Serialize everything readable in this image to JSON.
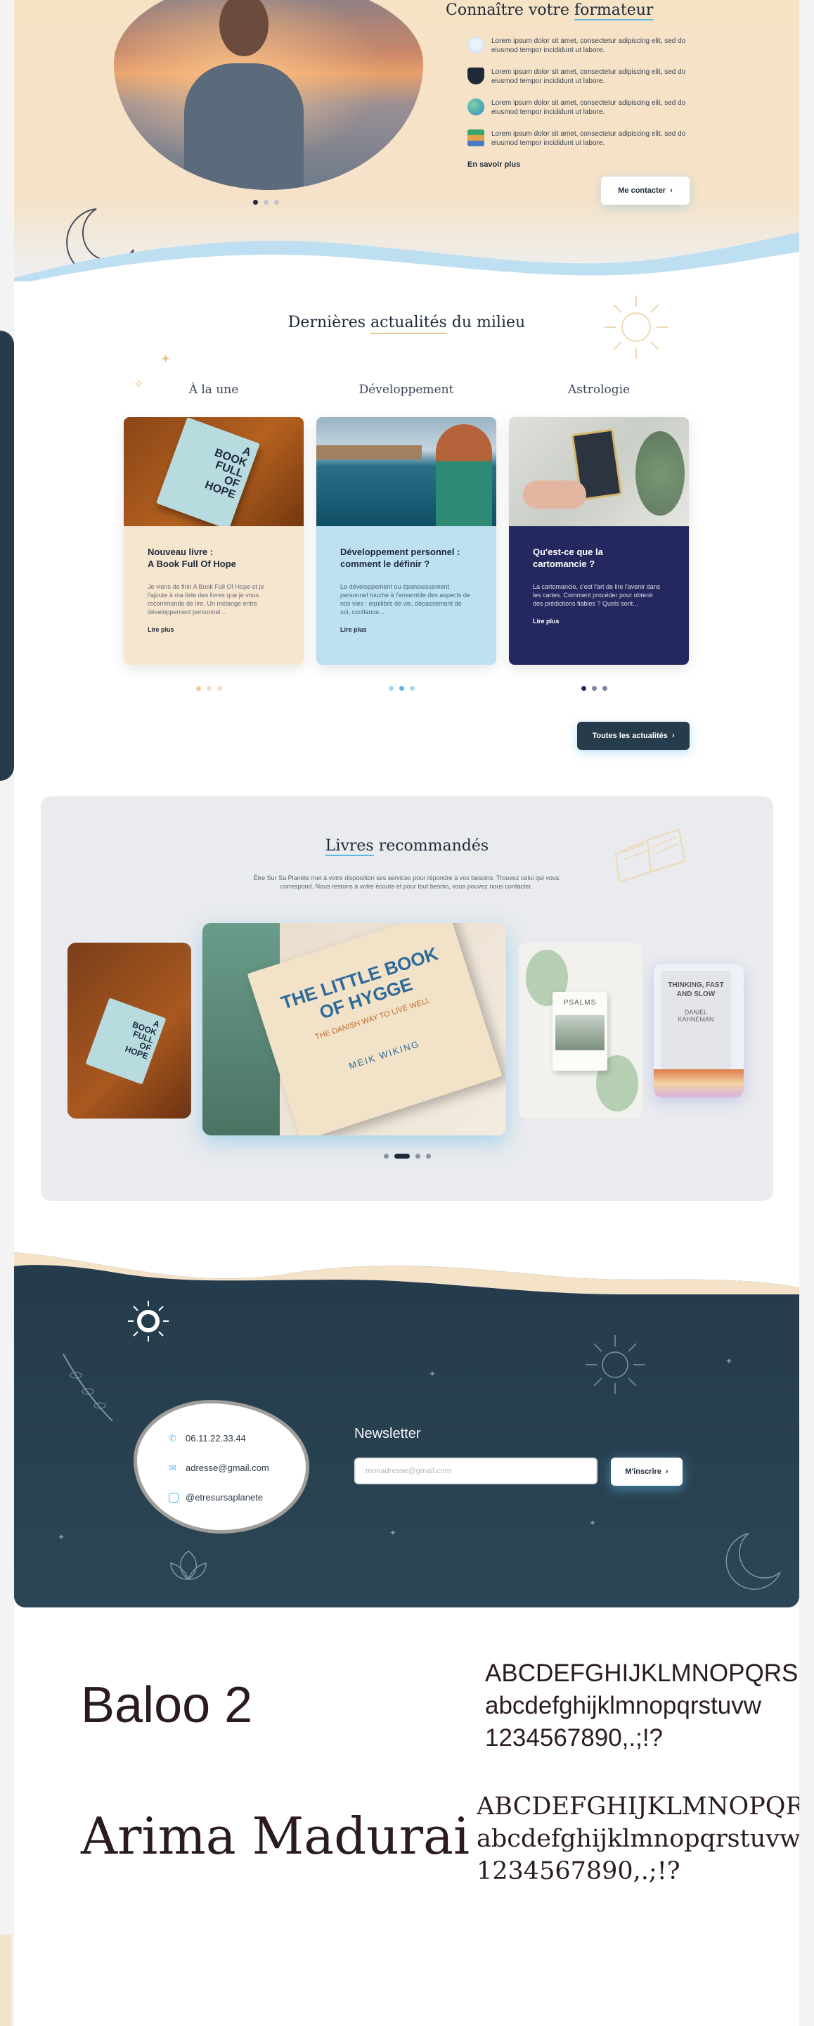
{
  "trainer": {
    "title_pre": "Connaître votre ",
    "title_hl": "formateur",
    "features": [
      "Lorem ipsum dolor sit amet, consectetur adipiscing elit, sed do eiusmod tempor incididunt ut labore.",
      "Lorem ipsum dolor sit amet, consectetur adipiscing elit, sed do eiusmod tempor incididunt ut labore.",
      "Lorem ipsum dolor sit amet, consectetur adipiscing elit, sed do eiusmod tempor incididunt ut labore.",
      "Lorem ipsum dolor sit amet, consectetur adipiscing elit, sed do eiusmod tempor incididunt ut labore."
    ],
    "learn_more": "En savoir plus",
    "contact_button": "Me contacter"
  },
  "news": {
    "title_pre": "Dernières ",
    "title_hl": "actualités",
    "title_post": " du milieu",
    "columns": [
      {
        "heading": "À la une",
        "title": "Nouveau livre :\nA Book Full Of Hope",
        "excerpt": "Je viens de finir A Book Full Of Hope et je l'ajoute à ma liste des livres que je vous recommande de lire. Un mélange entre développement personnel...",
        "more": "Lire plus",
        "book_text": "A\nBOOK\nFULL\nOF\nHOPE"
      },
      {
        "heading": "Développement",
        "title": "Développement personnel :\ncomment le définir ?",
        "excerpt": "Le développement ou épanouissement personnel touche à l'ensemble des aspects de nos vies : équilibre de vie, dépassement de soi, confiance...",
        "more": "Lire plus"
      },
      {
        "heading": "Astrologie",
        "title": "Qu'est-ce que la\ncartomancie ?",
        "excerpt": "La cartomancie, c'est l'art de lire l'avenir dans les cartes. Comment procéder pour obtenir des prédictions fiables ? Quels sont...",
        "more": "Lire plus"
      }
    ],
    "all_button": "Toutes les actualités"
  },
  "books": {
    "title_hl": "Livres",
    "title_post": " recommandés",
    "description": "Être Sur Sa Planète met à votre disposition ses services pour répondre à vos besoins. Trouvez celui qui vous correspond. Nous restons à votre écoute et pour tout besoin, vous pouvez nous contacter.",
    "items": [
      {
        "cover": "A\nBOOK\nFULL\nOF\nHOPE"
      },
      {
        "cover": "THE LITTLE BOOK OF HYGGE",
        "subtitle": "THE DANISH WAY TO LIVE WELL",
        "author": "MEIK WIKING"
      },
      {
        "cover": "PSALMS"
      },
      {
        "cover": "THINKING, FAST AND SLOW",
        "author": "DANIEL KAHNEMAN"
      }
    ]
  },
  "footer": {
    "phone": "06.11.22.33.44",
    "email": "adresse@gmail.com",
    "social": "@etresursaplanete",
    "newsletter_title": "Newsletter",
    "newsletter_placeholder": "monadresse@gmail.com",
    "subscribe_button": "M'inscrire"
  },
  "typography": [
    {
      "name": "Baloo 2",
      "upper": "ABCDEFGHIJKLMNOPQRS",
      "lower": "abcdefghijklmnopqrstuvw",
      "digits": "1234567890,.;!?"
    },
    {
      "name": "Arima Madurai",
      "upper": "ABCDEFGHIJKLMNOPQRST",
      "lower": "abcdefghijklmnopqrstuvw",
      "digits": "1234567890,.;!?"
    }
  ],
  "icons": {
    "feature_icons": [
      "mind-icon",
      "graduation-cap-icon",
      "globe-icon",
      "books-icon"
    ],
    "contact_icons": [
      "phone-icon",
      "mail-icon",
      "instagram-icon"
    ]
  },
  "colors": {
    "navy": "#263c4c",
    "sand": "#f6e2c5",
    "sky": "#5bb6e3",
    "card_blue": "#bde1f3",
    "card_indigo": "#25285e"
  }
}
